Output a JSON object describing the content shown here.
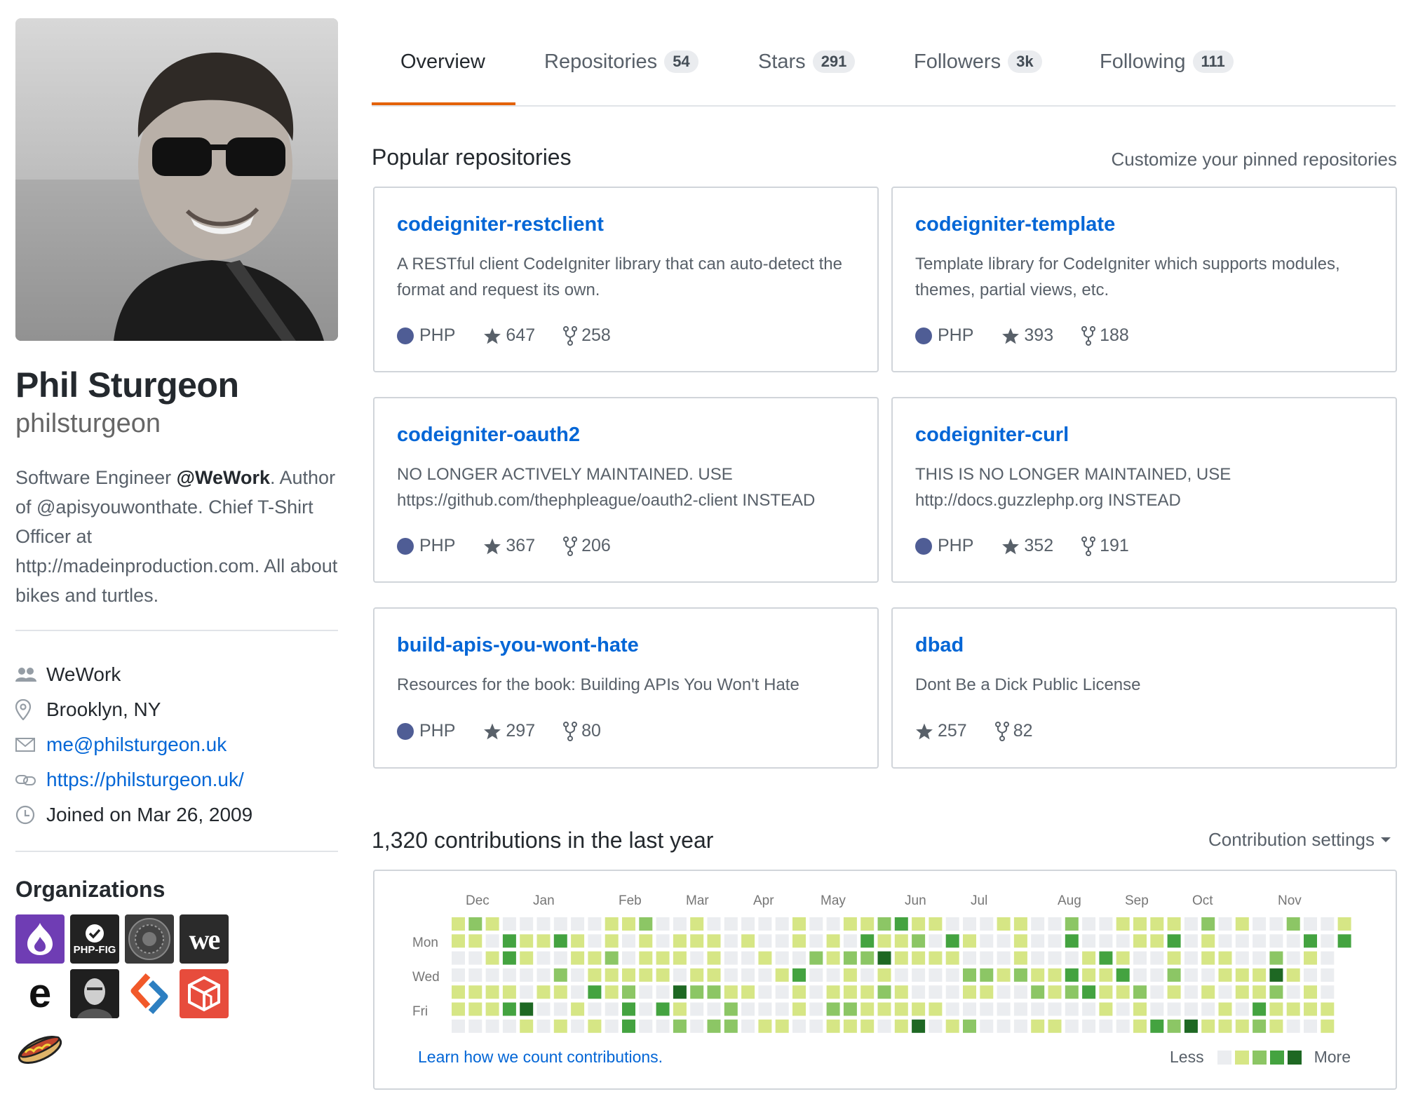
{
  "profile": {
    "full_name": "Phil Sturgeon",
    "login": "philsturgeon",
    "bio_prefix": "Software Engineer ",
    "bio_company": "@WeWork",
    "bio_rest": ". Author of @apisyouwonthate. Chief T-Shirt Officer at http://madeinproduction.com. All about bikes and turtles.",
    "vcard": [
      {
        "icon": "organization-icon",
        "text": "WeWork",
        "link": false
      },
      {
        "icon": "location-icon",
        "text": "Brooklyn, NY",
        "link": false
      },
      {
        "icon": "mail-icon",
        "text": "me@philsturgeon.uk",
        "link": true
      },
      {
        "icon": "link-icon",
        "text": "https://philsturgeon.uk/",
        "link": true
      },
      {
        "icon": "clock-icon",
        "text": "Joined on Mar 26, 2009",
        "link": false
      }
    ],
    "organizations_title": "Organizations",
    "organizations": [
      {
        "icon": "drupal-logo-icon",
        "color": "#6f3db4"
      },
      {
        "icon": "php-fig-logo-icon",
        "label": "PHP-FIG",
        "color": "#222222"
      },
      {
        "icon": "league-seal-icon",
        "color": "#3a3a3a"
      },
      {
        "icon": "wework-logo-icon",
        "label": "we",
        "color": "#2b2b2b"
      },
      {
        "icon": "e-logo-icon",
        "label": "e",
        "color": "#ffffff"
      },
      {
        "icon": "portrait-avatar-icon",
        "color": "#1f1f1f"
      },
      {
        "icon": "code-brackets-logo-icon",
        "color": "#ffffff"
      },
      {
        "icon": "cube-logo-icon",
        "color": "#e74c3c"
      },
      {
        "icon": "hotdog-icon",
        "color": "#ffffff"
      }
    ]
  },
  "tabs": [
    {
      "label": "Overview",
      "count": null,
      "selected": true
    },
    {
      "label": "Repositories",
      "count": "54"
    },
    {
      "label": "Stars",
      "count": "291"
    },
    {
      "label": "Followers",
      "count": "3k"
    },
    {
      "label": "Following",
      "count": "111"
    }
  ],
  "popular": {
    "title": "Popular repositories",
    "customize_link": "Customize your pinned repositories",
    "repos": [
      {
        "name": "codeigniter-restclient",
        "description": "A RESTful client CodeIgniter library that can auto-detect the format and request its own.",
        "language": "PHP",
        "stars": "647",
        "forks": "258"
      },
      {
        "name": "codeigniter-template",
        "description": "Template library for CodeIgniter which supports modules, themes, partial views, etc.",
        "language": "PHP",
        "stars": "393",
        "forks": "188"
      },
      {
        "name": "codeigniter-oauth2",
        "description": "NO LONGER ACTIVELY MAINTAINED. USE https://github.com/thephpleague/oauth2-client INSTEAD",
        "language": "PHP",
        "stars": "367",
        "forks": "206"
      },
      {
        "name": "codeigniter-curl",
        "description": "THIS IS NO LONGER MAINTAINED, USE http://docs.guzzlephp.org INSTEAD",
        "language": "PHP",
        "stars": "352",
        "forks": "191"
      },
      {
        "name": "build-apis-you-wont-hate",
        "description": "Resources for the book: Building APIs You Won't Hate",
        "language": "PHP",
        "stars": "297",
        "forks": "80"
      },
      {
        "name": "dbad",
        "description": "Dont Be a Dick Public License",
        "language": null,
        "stars": "257",
        "forks": "82"
      }
    ],
    "language_color": "#4F5D95"
  },
  "contributions": {
    "title": "1,320 contributions in the last year",
    "settings_label": "Contribution settings",
    "months": [
      "Dec",
      "Jan",
      "Feb",
      "Mar",
      "Apr",
      "May",
      "Jun",
      "Jul",
      "Aug",
      "Sep",
      "Oct",
      "Nov"
    ],
    "days": [
      "Mon",
      "Wed",
      "Fri"
    ],
    "learn_link": "Learn how we count contributions.",
    "legend_less": "Less",
    "legend_more": "More",
    "level_colors": [
      "#ebedf0",
      "#d6e685",
      "#8cc665",
      "#44a340",
      "#1e6823"
    ]
  }
}
